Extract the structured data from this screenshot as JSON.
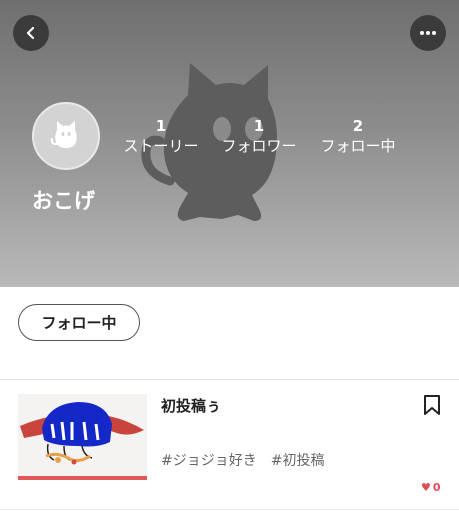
{
  "profile": {
    "username": "おこげ",
    "stats": [
      {
        "count": "1",
        "label": "ストーリー"
      },
      {
        "count": "1",
        "label": "フォロワー"
      },
      {
        "count": "2",
        "label": "フォロー中"
      }
    ],
    "follow_button": "フォロー中"
  },
  "icons": {
    "back": "chevron-left-icon",
    "more": "more-horizontal-icon",
    "bookmark": "bookmark-icon",
    "heart": "heart-icon"
  },
  "colors": {
    "header_gradient_top": "#6f6f6f",
    "header_gradient_bottom": "#b9b9b9",
    "like_red": "#e34a57"
  },
  "stories": [
    {
      "title": "初投稿ぅ",
      "tags": [
        "#ジョジョ好き",
        "#初投稿"
      ],
      "likes": "0"
    }
  ]
}
